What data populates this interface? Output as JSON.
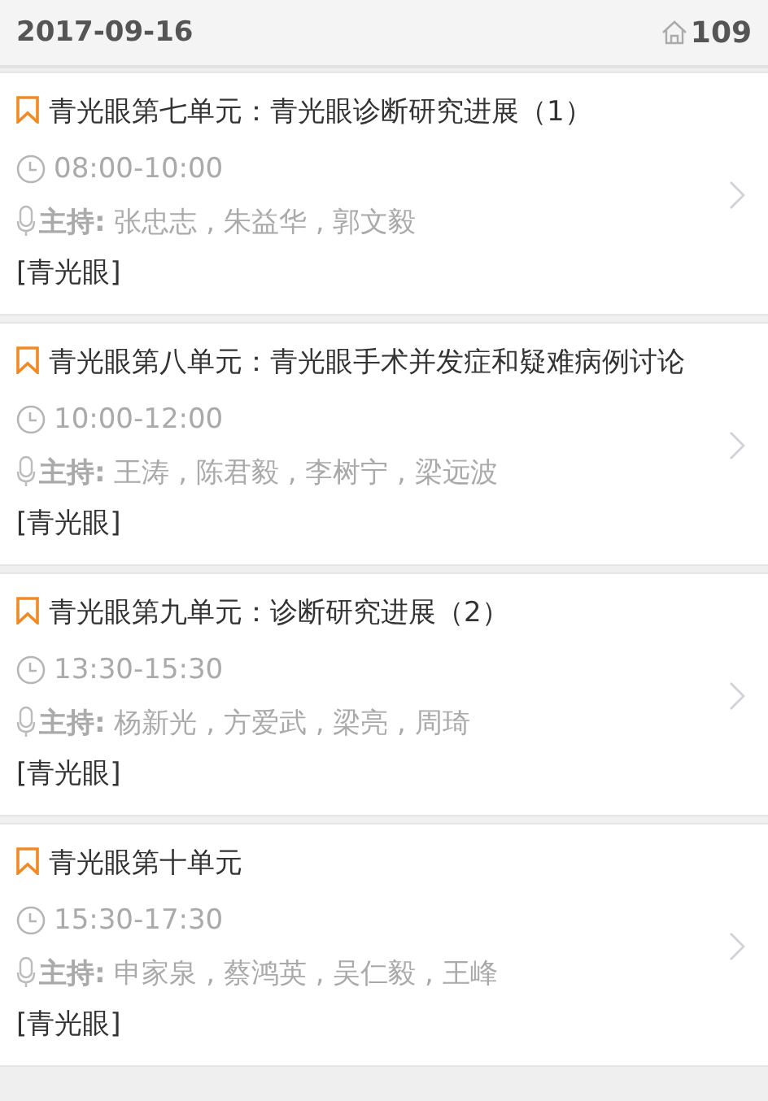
{
  "header": {
    "date": "2017-09-16",
    "room": "109"
  },
  "sessions": [
    {
      "title": "青光眼第七单元：青光眼诊断研究进展（1）",
      "time": "08:00-10:00",
      "host": "**主持:** 张忠志 , 朱益华 , 郭文毅",
      "tag": "[青光眼]"
    },
    {
      "title": "青光眼第八单元：青光眼手术并发症和疑难病例讨论",
      "time": "10:00-12:00",
      "host": "**主持:** 王涛 , 陈君毅 , 李树宁 , 梁远波",
      "tag": "[青光眼]"
    },
    {
      "title": "青光眼第九单元：诊断研究进展（2）",
      "time": "13:30-15:30",
      "host": "**主持:** 杨新光 , 方爱武 , 梁亮 , 周琦",
      "tag": "[青光眼]"
    },
    {
      "title": "青光眼第十单元",
      "time": "15:30-17:30",
      "host": "**主持:** 申家泉 , 蔡鸿英 , 吴仁毅 , 王峰",
      "tag": "[青光眼]"
    }
  ]
}
